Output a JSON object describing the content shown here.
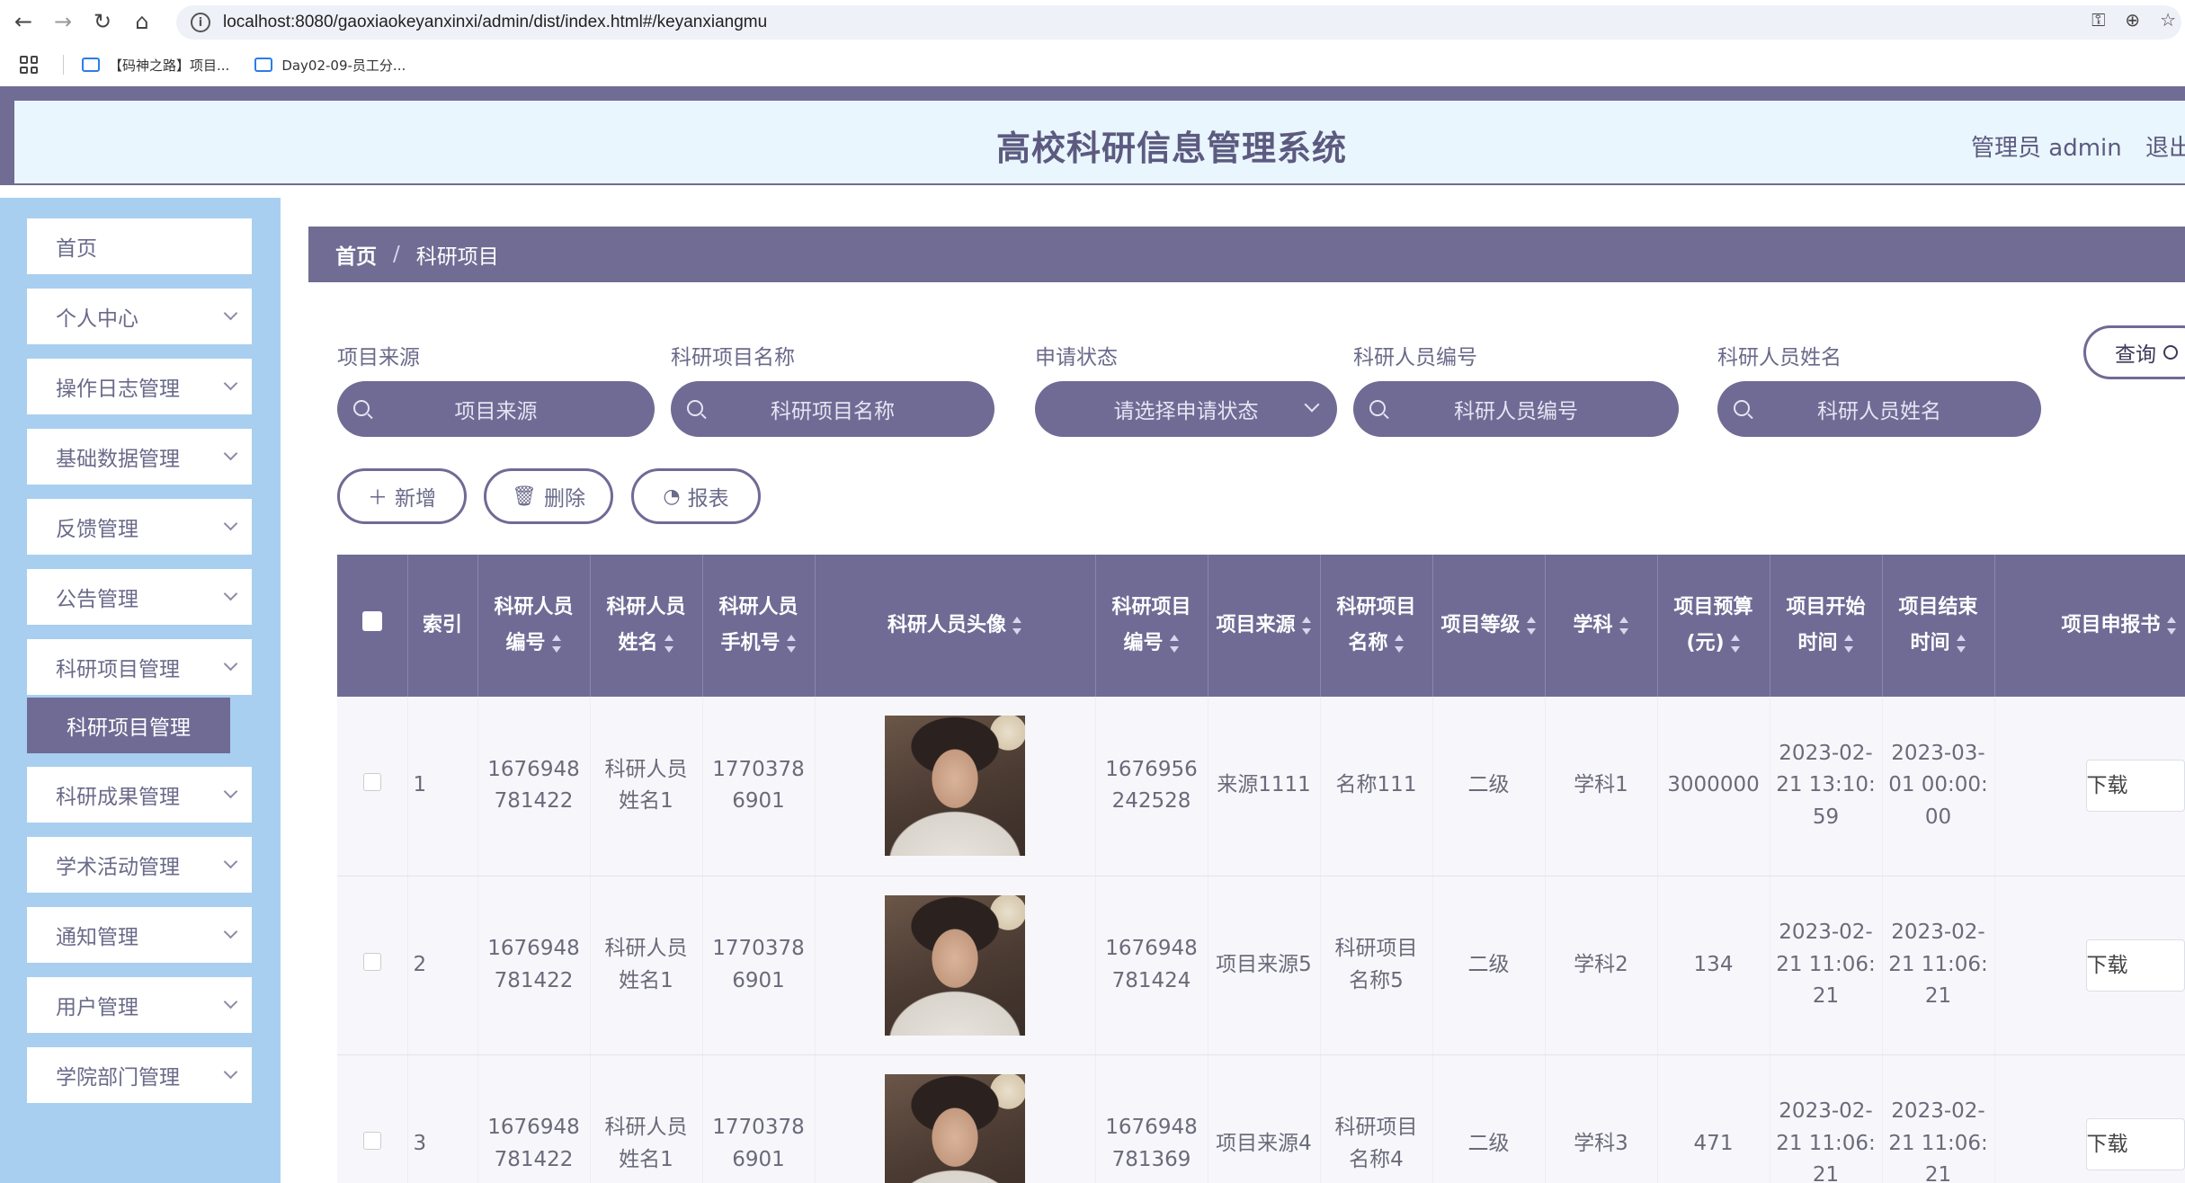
{
  "browser": {
    "url": "localhost:8080/gaoxiaokeyanxinxi/admin/dist/index.html#/keyanxiangmu",
    "bookmarks": [
      "【码神之路】项目...",
      "Day02-09-员工分..."
    ]
  },
  "header": {
    "title": "高校科研信息管理系统",
    "user": "管理员 admin",
    "logout": "退出"
  },
  "sidebar": {
    "items": [
      {
        "label": "首页",
        "has_children": false
      },
      {
        "label": "个人中心",
        "has_children": true
      },
      {
        "label": "操作日志管理",
        "has_children": true
      },
      {
        "label": "基础数据管理",
        "has_children": true
      },
      {
        "label": "反馈管理",
        "has_children": true
      },
      {
        "label": "公告管理",
        "has_children": true
      },
      {
        "label": "科研项目管理",
        "has_children": true
      },
      {
        "label": "科研成果管理",
        "has_children": true
      },
      {
        "label": "学术活动管理",
        "has_children": true
      },
      {
        "label": "通知管理",
        "has_children": true
      },
      {
        "label": "用户管理",
        "has_children": true
      },
      {
        "label": "学院部门管理",
        "has_children": true
      }
    ],
    "active_sub": "科研项目管理"
  },
  "breadcrumb": {
    "home": "首页",
    "sep": "/",
    "current": "科研项目"
  },
  "filters": [
    {
      "label": "项目来源",
      "placeholder": "项目来源",
      "type": "input"
    },
    {
      "label": "科研项目名称",
      "placeholder": "科研项目名称",
      "type": "input"
    },
    {
      "label": "申请状态",
      "placeholder": "请选择申请状态",
      "type": "select"
    },
    {
      "label": "科研人员编号",
      "placeholder": "科研人员编号",
      "type": "input"
    },
    {
      "label": "科研人员姓名",
      "placeholder": "科研人员姓名",
      "type": "input"
    }
  ],
  "query_label": "查询",
  "actions": {
    "add": "新增",
    "delete": "删除",
    "report": "报表"
  },
  "table": {
    "headers": [
      {
        "l1": "索引",
        "l2": "",
        "sortable": false
      },
      {
        "l1": "科研人员",
        "l2": "编号",
        "sortable": true
      },
      {
        "l1": "科研人员",
        "l2": "姓名",
        "sortable": true
      },
      {
        "l1": "科研人员",
        "l2": "手机号",
        "sortable": true
      },
      {
        "l1": "科研人员头像",
        "l2": "",
        "sortable": true
      },
      {
        "l1": "科研项目",
        "l2": "编号",
        "sortable": true
      },
      {
        "l1": "项目来源",
        "l2": "",
        "sortable": true
      },
      {
        "l1": "科研项目",
        "l2": "名称",
        "sortable": true
      },
      {
        "l1": "项目等级",
        "l2": "",
        "sortable": true
      },
      {
        "l1": "学科",
        "l2": "",
        "sortable": true
      },
      {
        "l1": "项目预算",
        "l2": "(元)",
        "sortable": true
      },
      {
        "l1": "项目开始",
        "l2": "时间",
        "sortable": true
      },
      {
        "l1": "项目结束",
        "l2": "时间",
        "sortable": true
      },
      {
        "l1": "项目申报书",
        "l2": "",
        "sortable": true
      }
    ],
    "rows": [
      {
        "index": "1",
        "researcher_no": "1676948781422",
        "researcher_name": "科研人员姓名1",
        "phone": "17703786901",
        "project_no": "1676956242528",
        "source": "来源1111",
        "name": "名称111",
        "level": "二级",
        "subject": "学科1",
        "budget": "3000000",
        "start": "2023-02-21 13:10:59",
        "end": "2023-03-01 00:00:00",
        "file_btn": "下载"
      },
      {
        "index": "2",
        "researcher_no": "1676948781422",
        "researcher_name": "科研人员姓名1",
        "phone": "17703786901",
        "project_no": "1676948781424",
        "source": "项目来源5",
        "name": "科研项目名称5",
        "level": "二级",
        "subject": "学科2",
        "budget": "134",
        "start": "2023-02-21 11:06:21",
        "end": "2023-02-21 11:06:21",
        "file_btn": "下载"
      },
      {
        "index": "3",
        "researcher_no": "1676948781422",
        "researcher_name": "科研人员姓名1",
        "phone": "17703786901",
        "project_no": "1676948781369",
        "source": "项目来源4",
        "name": "科研项目名称4",
        "level": "二级",
        "subject": "学科3",
        "budget": "471",
        "start": "2023-02-21 11:06:21",
        "end": "2023-02-21 11:06:21",
        "file_btn": "下载"
      }
    ]
  }
}
